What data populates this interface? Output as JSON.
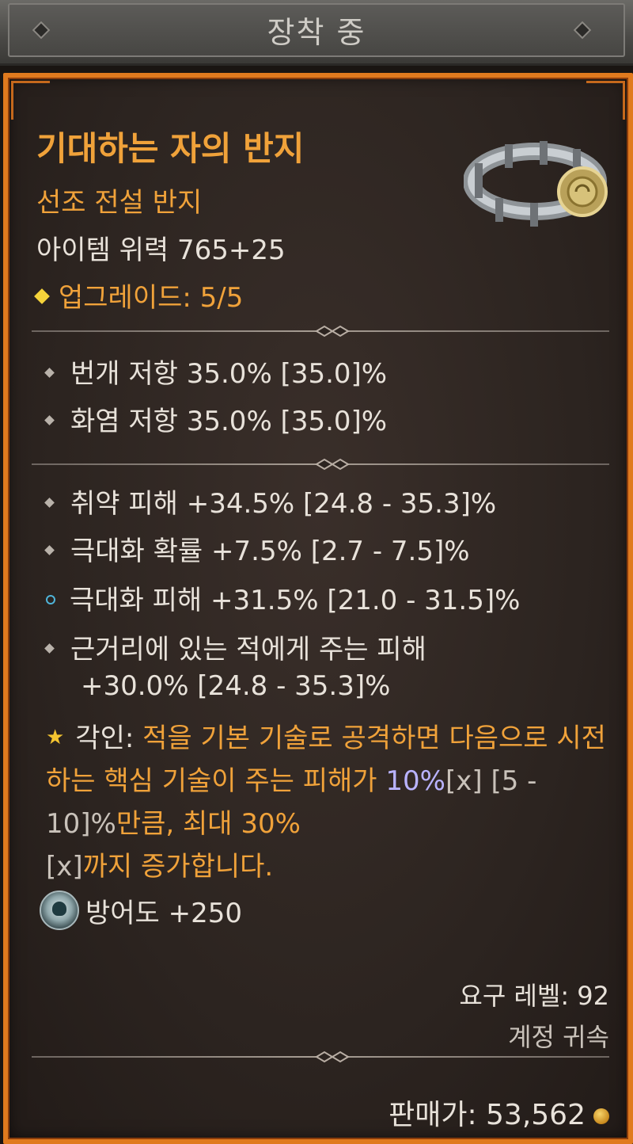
{
  "header": {
    "title": "장착 중"
  },
  "item": {
    "name": "기대하는 자의 반지",
    "type": "선조 전설 반지",
    "power": "아이템 위력 765+25",
    "upgrade": "업그레이드: 5/5"
  },
  "base_stats": [
    "번개 저항 35.0% [35.0]%",
    "화염 저항 35.0% [35.0]%"
  ],
  "affixes": [
    {
      "text": "취약 피해 +34.5% [24.8 - 35.3]%",
      "bullet": "diamond"
    },
    {
      "text": "극대화 확률 +7.5% [2.7 - 7.5]%",
      "bullet": "diamond"
    },
    {
      "text": "극대화 피해 +31.5% [21.0 - 31.5]%",
      "bullet": "blue-ring"
    },
    {
      "text": "근거리에 있는 적에게 주는 피해",
      "text2": "+30.0% [24.8 - 35.3]%",
      "bullet": "diamond"
    }
  ],
  "aspect": {
    "label": "각인:",
    "part1": "적을 기본 기술로 공격하면 다음으로 시전하는 핵심 기술이 주는 피해가 ",
    "value": "10%",
    "x1": "[x]",
    "range": " [5 - 10]%",
    "part2": "만큼, 최대 30%",
    "x2": "[x]",
    "part3": "까지 증가합니다."
  },
  "armor": "방어도 +250",
  "requirement": "요구 레벨: 92",
  "binding": "계정 귀속",
  "sell_price": "판매가: 53,562",
  "colors": {
    "legendary": "#f0a23a",
    "border": "#e07a1e",
    "greater_affix": "#4fb4d9"
  }
}
